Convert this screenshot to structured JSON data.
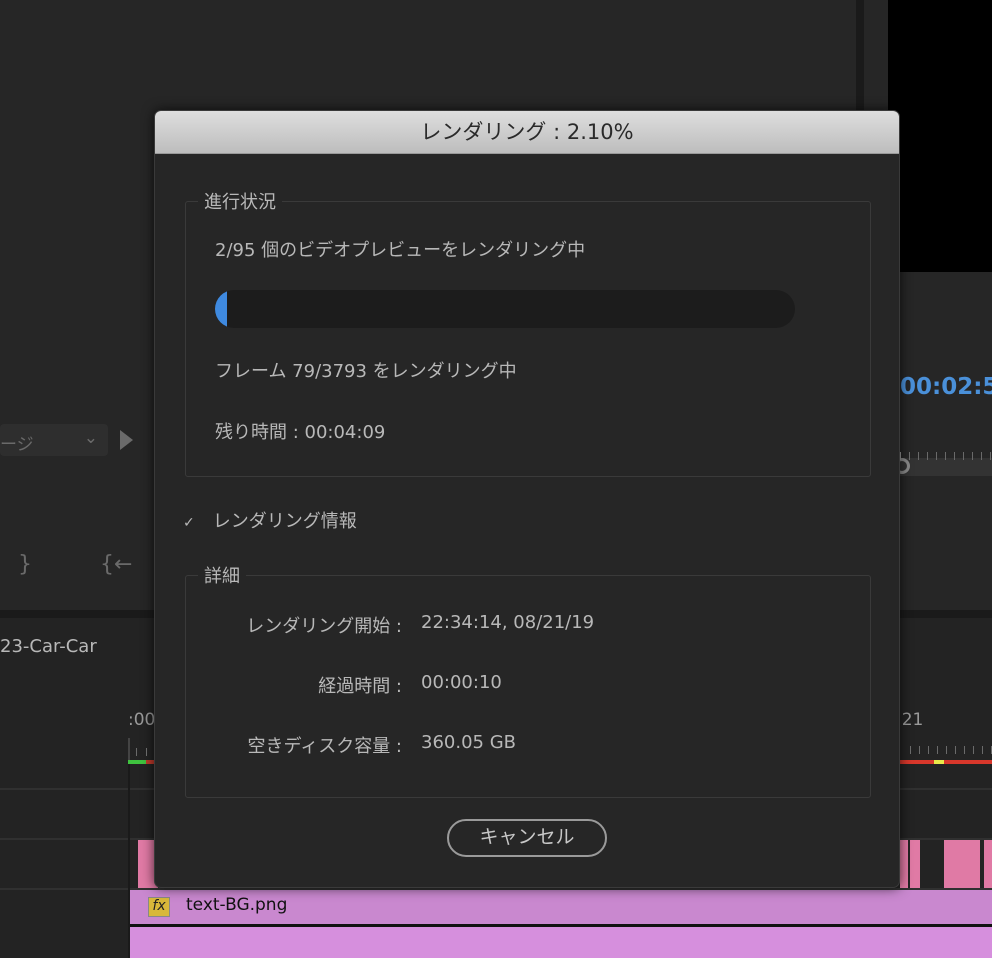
{
  "background": {
    "source_dropdown": "ージ",
    "sequence_name": "23-Car-Car",
    "timeline_start": ":00",
    "timeline_marker": ":21",
    "program_timecode": "00:02:5",
    "clip_fx": "fx",
    "clip_name": "text-BG.png"
  },
  "dialog": {
    "title": "レンダリング : 2.10%",
    "progress_group": {
      "label": "進行状況",
      "status": "2/95 個のビデオプレビューをレンダリング中",
      "progress_percent": 2.1,
      "frame_status": "フレーム 79/3793 をレンダリング中",
      "remaining": "残り時間 : 00:04:09"
    },
    "info_toggle": "レンダリング情報",
    "details_group": {
      "label": "詳細",
      "rows": [
        {
          "label": "レンダリング開始 :",
          "value": "22:34:14, 08/21/19"
        },
        {
          "label": "経過時間 :",
          "value": "00:00:10"
        },
        {
          "label": "空きディスク容量 :",
          "value": "360.05 GB"
        }
      ]
    },
    "cancel": "キャンセル"
  },
  "colors": {
    "accent": "#3f8ae0",
    "timecode": "#4a90d9"
  }
}
